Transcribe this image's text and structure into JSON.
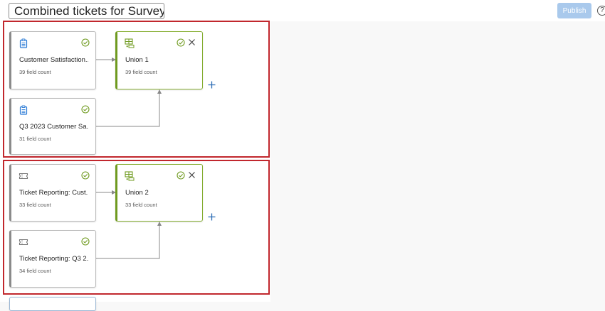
{
  "header": {
    "title": "Combined tickets for Survey...",
    "publish_label": "Publish",
    "help_label": "?"
  },
  "colors": {
    "frame": "#c1272d",
    "check": "#6f9a1f",
    "union_accent": "#84ad2f",
    "survey_icon": "#2b7bd6",
    "publish_bg": "#a9c9ec",
    "add_icon": "#2b6cb5"
  },
  "groups": [
    {
      "sources": [
        {
          "name": "Customer Satisfaction...",
          "field_count": "39 field count",
          "icon": "clipboard-icon"
        },
        {
          "name": "Q3 2023 Customer Sa...",
          "field_count": "31 field count",
          "icon": "clipboard-icon"
        }
      ],
      "union": {
        "name": "Union 1",
        "field_count": "39 field count",
        "icon": "union-table-icon"
      }
    },
    {
      "sources": [
        {
          "name": "Ticket Reporting: Cust...",
          "field_count": "33 field count",
          "icon": "ticket-icon"
        },
        {
          "name": "Ticket Reporting: Q3 2...",
          "field_count": "34 field count",
          "icon": "ticket-icon"
        }
      ],
      "union": {
        "name": "Union 2",
        "field_count": "33 field count",
        "icon": "union-table-icon"
      }
    }
  ]
}
